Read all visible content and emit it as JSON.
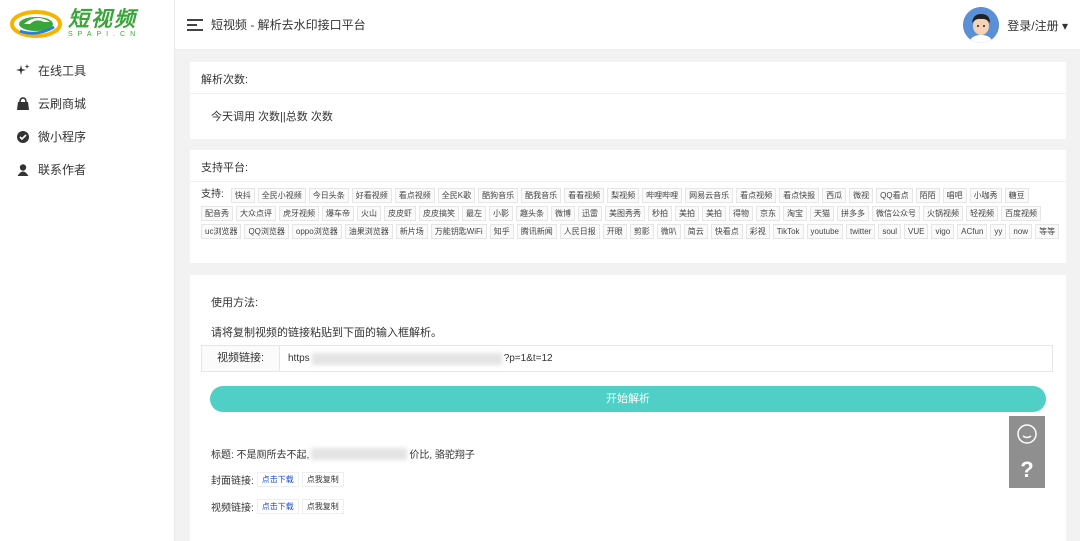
{
  "logo": {
    "title": "短视频",
    "subtitle": "SPAPI.CN"
  },
  "sidebar": {
    "items": [
      {
        "label": "在线工具",
        "icon": "sparkle-icon"
      },
      {
        "label": "云刷商城",
        "icon": "bag-icon"
      },
      {
        "label": "微小程序",
        "icon": "check-circle-icon"
      },
      {
        "label": "联系作者",
        "icon": "user-icon"
      }
    ]
  },
  "header": {
    "title": "短视频 - 解析去水印接口平台",
    "login": "登录/注册 ▾"
  },
  "stats": {
    "label": "解析次数:",
    "text": "今天调用 次数||总数 次数"
  },
  "platforms": {
    "label": "支持平台:",
    "lead": "支持:",
    "items": [
      "快抖",
      "全民小视频",
      "今日头条",
      "好看视频",
      "看点视频",
      "全民K歌",
      "酷狗音乐",
      "酷我音乐",
      "看看视频",
      "梨视频",
      "哔哩哔哩",
      "网易云音乐",
      "看点视频",
      "看点快报",
      "西瓜",
      "微视",
      "QQ看点",
      "陌陌",
      "唱吧",
      "小咖秀",
      "糖豆",
      "配音秀",
      "大众点评",
      "虎牙视频",
      "爆车帝",
      "火山",
      "皮皮虾",
      "皮皮搞笑",
      "最左",
      "小影",
      "趣头条",
      "微博",
      "迅雷",
      "美图秀秀",
      "秒拍",
      "美拍",
      "美拍",
      "得物",
      "京东",
      "淘宝",
      "天猫",
      "拼多多",
      "微信公众号",
      "火锅视频",
      "轻视频",
      "百度视频",
      "uc浏览器",
      "QQ浏览器",
      "oppo浏览器",
      "油果浏览器",
      "新片场",
      "万能钥匙WiFi",
      "知乎",
      "腾讯新闻",
      "人民日报",
      "开眼",
      "剪影",
      "微叭",
      "简云",
      "快看点",
      "彩视",
      "TikTok",
      "youtube",
      "twitter",
      "soul",
      "VUE",
      "vigo",
      "ACfun",
      "yy",
      "now",
      "等等"
    ]
  },
  "usage": {
    "label": "使用方法:",
    "instruction": "请将复制视频的链接粘贴到下面的输入框解析。",
    "input_label": "视频链接:",
    "input_prefix": "https",
    "input_suffix": "?p=1&t=12",
    "parse_button": "开始解析"
  },
  "result": {
    "title_label": "标题: 不是厕所去不起,",
    "title_suffix": "价比, 骆驼翔子",
    "cover_label": "封面链接:",
    "video_label": "视频链接:",
    "download": "点击下载",
    "copy": "点我复制"
  },
  "float": {
    "help": "?"
  },
  "colors": {
    "accent": "#4fcfc5",
    "brand": "#3aa63a",
    "link": "#1a4ccf"
  }
}
